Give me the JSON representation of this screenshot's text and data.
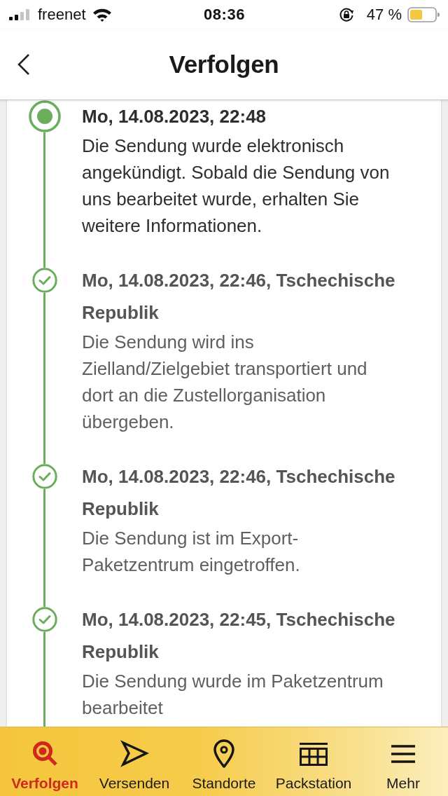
{
  "status_bar": {
    "carrier": "freenet",
    "time": "08:36",
    "battery": "47 %"
  },
  "header": {
    "title": "Verfolgen"
  },
  "events": [
    {
      "date": "Mo, 14.08.2023, 22:48",
      "text": "Die Sendung wurde elektronisch angekündigt. Sobald die Sendung von uns bearbeitet wurde, erhalten Sie weitere Informationen.",
      "current": true
    },
    {
      "date": "Mo, 14.08.2023, 22:46, Tschechische Republik",
      "text": "Die Sendung wird ins Zielland/Zielgebiet transportiert und dort an die Zustellorganisation übergeben.",
      "current": false
    },
    {
      "date": "Mo, 14.08.2023, 22:46, Tschechische Republik",
      "text": "Die Sendung ist im Export-Paketzentrum eingetroffen.",
      "current": false
    },
    {
      "date": "Mo, 14.08.2023, 22:45, Tschechische Republik",
      "text": "Die Sendung wurde im Paketzentrum bearbeitet",
      "current": false
    }
  ],
  "tab_bar": [
    {
      "label": "Verfolgen",
      "selected": true
    },
    {
      "label": "Versenden",
      "selected": false
    },
    {
      "label": "Standorte",
      "selected": false
    },
    {
      "label": "Packstation",
      "selected": false
    },
    {
      "label": "Mehr",
      "selected": false
    }
  ]
}
